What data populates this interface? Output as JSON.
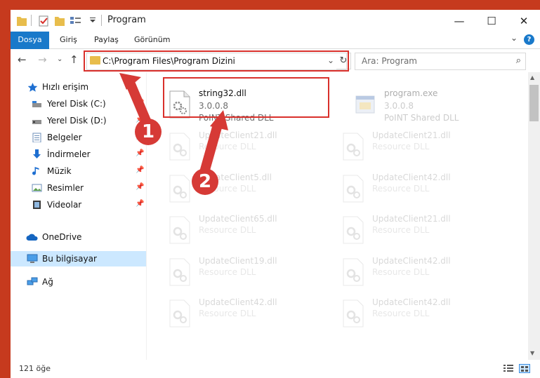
{
  "window": {
    "title": "Program",
    "controls": {
      "minimize": "—",
      "maximize": "☐",
      "close": "✕"
    }
  },
  "ribbon": {
    "tabs": [
      {
        "label": "Dosya",
        "active": true
      },
      {
        "label": "Giriş"
      },
      {
        "label": "Paylaş"
      },
      {
        "label": "Görünüm"
      }
    ],
    "help": "?"
  },
  "address": {
    "path": "C:\\Program Files\\Program Dizini",
    "search_placeholder": "Ara: Program"
  },
  "nav": {
    "items": [
      {
        "label": "Hızlı erişim",
        "icon": "star-icon",
        "color": "#1e6fd1"
      },
      {
        "label": "Yerel Disk (C:)",
        "icon": "drive-icon",
        "pinned": true
      },
      {
        "label": "Yerel Disk (D:)",
        "icon": "drive-icon",
        "pinned": true
      },
      {
        "label": "Belgeler",
        "icon": "documents-icon",
        "pinned": true
      },
      {
        "label": "İndirmeler",
        "icon": "downloads-icon",
        "pinned": true
      },
      {
        "label": "Müzik",
        "icon": "music-icon",
        "pinned": true
      },
      {
        "label": "Resimler",
        "icon": "pictures-icon",
        "pinned": true
      },
      {
        "label": "Videolar",
        "icon": "videos-icon",
        "pinned": true
      },
      {
        "label": "OneDrive",
        "icon": "onedrive-icon"
      },
      {
        "label": "Bu bilgisayar",
        "icon": "computer-icon",
        "selected": true
      },
      {
        "label": "Ağ",
        "icon": "network-icon"
      }
    ]
  },
  "files": [
    {
      "name": "string32.dll",
      "version": "3.0.0.8",
      "desc": "PoINT Shared DLL",
      "type": "dll"
    },
    {
      "name": "program.exe",
      "version": "3.0.0.8",
      "desc": "PoINT Shared DLL",
      "type": "exe",
      "faded": true
    },
    {
      "name": "UpdateClient21.dll",
      "desc": "Resource DLL",
      "type": "dll",
      "faded": true
    },
    {
      "name": "UpdateClient21.dll",
      "desc": "Resource DLL",
      "type": "dll",
      "faded": true
    },
    {
      "name": "UpdateClient5.dll",
      "desc": "Resource DLL",
      "type": "dll",
      "faded": true
    },
    {
      "name": "UpdateClient42.dll",
      "desc": "Resource DLL",
      "type": "dll",
      "faded": true
    },
    {
      "name": "UpdateClient65.dll",
      "desc": "Resource DLL",
      "type": "dll",
      "faded": true
    },
    {
      "name": "UpdateClient21.dll",
      "desc": "Resource DLL",
      "type": "dll",
      "faded": true
    },
    {
      "name": "UpdateClient19.dll",
      "desc": "Resource DLL",
      "type": "dll",
      "faded": true
    },
    {
      "name": "UpdateClient42.dll",
      "desc": "Resource DLL",
      "type": "dll",
      "faded": true
    },
    {
      "name": "UpdateClient42.dll",
      "desc": "Resource DLL",
      "type": "dll",
      "faded": true
    },
    {
      "name": "UpdateClient42.dll",
      "desc": "Resource DLL",
      "type": "dll",
      "faded": true
    }
  ],
  "status": {
    "count": "121 öğe"
  },
  "annotations": {
    "step1": "1",
    "step2": "2",
    "color": "#d9302b"
  }
}
